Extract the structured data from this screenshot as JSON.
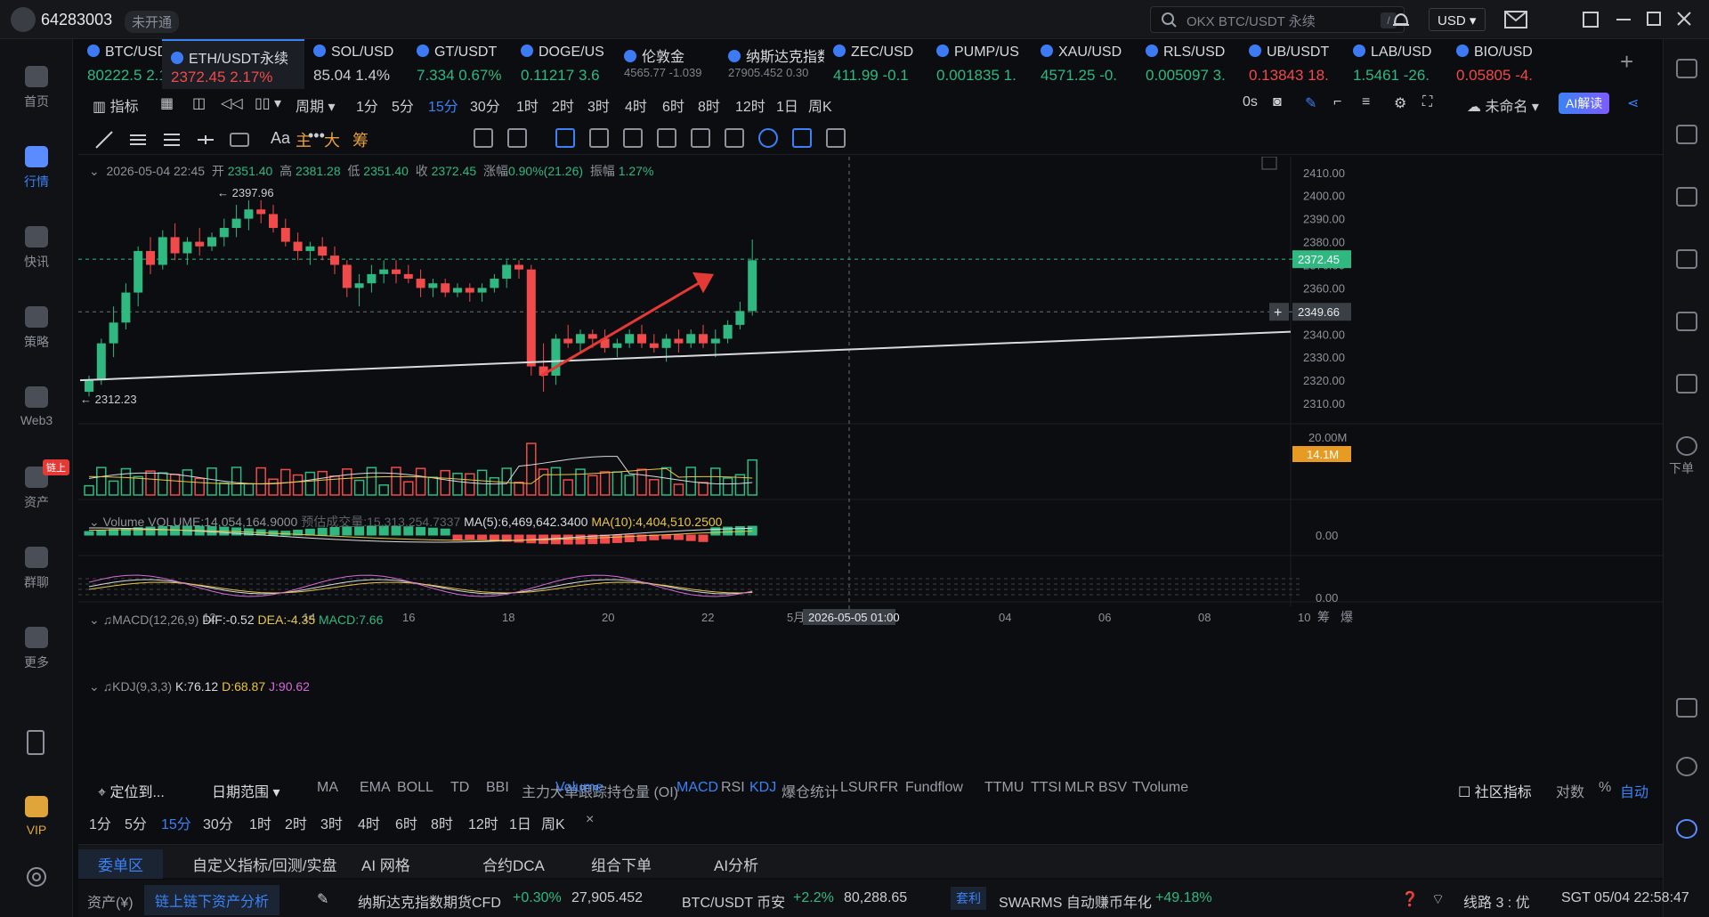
{
  "titlebar": {
    "user_id": "64283003",
    "badge": "未开通",
    "search_placeholder": "OKX BTC/USDT 永续",
    "currency": "USD"
  },
  "nav": [
    {
      "label": "首页"
    },
    {
      "label": "行情"
    },
    {
      "label": "快讯"
    },
    {
      "label": "策略"
    },
    {
      "label": "Web3"
    },
    {
      "label": "资产",
      "tag": "链上"
    },
    {
      "label": "群聊"
    },
    {
      "label": "更多"
    },
    {
      "label": "VIP"
    }
  ],
  "tickers": [
    {
      "name": "BTC/USD",
      "price": "80222.5",
      "change": "2.1",
      "dir": "up"
    },
    {
      "name": "ETH/USDT永续",
      "price": "2372.45",
      "change": "2.17%",
      "dir": "dn"
    },
    {
      "name": "SOL/USD",
      "price": "85.04",
      "change": "1.4%",
      "dir": "none"
    },
    {
      "name": "GT/USDT",
      "price": "7.334",
      "change": "0.67%",
      "dir": "up"
    },
    {
      "name": "DOGE/US",
      "price": "0.11217",
      "change": "3.6",
      "dir": "up"
    },
    {
      "name": "伦敦金",
      "price": "4565.77",
      "change": "-1.039",
      "dir": "mut"
    },
    {
      "name": "纳斯达克指数",
      "price": "27905.452",
      "change": "0.30",
      "dir": "mut"
    },
    {
      "name": "ZEC/USD",
      "price": "411.99",
      "change": "-0.1",
      "dir": "up"
    },
    {
      "name": "PUMP/US",
      "price": "0.001835",
      "change": "1.",
      "dir": "up"
    },
    {
      "name": "XAU/USD",
      "price": "4571.25",
      "change": "-0.",
      "dir": "up"
    },
    {
      "name": "RLS/USD",
      "price": "0.005097",
      "change": "3.",
      "dir": "up"
    },
    {
      "name": "UB/USDT",
      "price": "0.13843",
      "change": "18.",
      "dir": "dn"
    },
    {
      "name": "LAB/USD",
      "price": "1.5461",
      "change": "-26.",
      "dir": "up"
    },
    {
      "name": "BIO/USD",
      "price": "0.05805",
      "change": "-4.",
      "dir": "dn"
    }
  ],
  "toolbar": {
    "indicator": "指标",
    "period": "周期",
    "intervals": [
      "1分",
      "5分",
      "15分",
      "30分",
      "1时",
      "2时",
      "3时",
      "4时",
      "6时",
      "8时",
      "12时",
      "1日",
      "周K"
    ],
    "active_interval": "15分",
    "countdown": "0s",
    "layout_name": "未命名",
    "ai": "AI解读",
    "draw_labels": [
      "Aa",
      "主",
      "大",
      "筹"
    ]
  },
  "ohlc": {
    "date": "2026-05-04 22:45",
    "open_label": "开",
    "open": "2351.40",
    "high_label": "高",
    "high": "2381.28",
    "low_label": "低",
    "low": "2351.40",
    "close_label": "收",
    "close": "2372.45",
    "chg_label": "涨幅",
    "chg": "0.90%(21.26)",
    "amp_label": "振幅",
    "amp": "1.27%"
  },
  "volume_header": {
    "title": "Volume",
    "volume": "VOLUME:14,054,164.9000",
    "est": "预估成交量:15,313,254.7337",
    "ma5": "MA(5):6,469,642.3400",
    "ma10": "MA(10):4,404,510.2500"
  },
  "macd_header": {
    "title": "MACD(12,26,9)",
    "dif": "DIF:-0.52",
    "dea": "DEA:-4.35",
    "macd": "MACD:7.66"
  },
  "kdj_header": {
    "title": "KDJ(9,3,3)",
    "k": "K:76.12",
    "d": "D:68.87",
    "j": "J:90.62"
  },
  "price_axis": [
    "2410.00",
    "2400.00",
    "2390.00",
    "2380.00",
    "2370.00",
    "2360.00",
    "2350.00",
    "2340.00",
    "2330.00",
    "2320.00",
    "2310.00"
  ],
  "price_tags": {
    "last": "2372.45",
    "cross": "2349.66",
    "max": "2397.96",
    "min": "2312.23"
  },
  "vol_axis": {
    "top": "20.00M",
    "tag": "14.1M"
  },
  "macd_axis": "0.00",
  "kdj_axis": "0.00",
  "time_axis": [
    "12",
    "14",
    "16",
    "18",
    "20",
    "22",
    "04",
    "06",
    "08",
    "10"
  ],
  "time_axis_month": "5月",
  "time_cursor": "2026-05-05 01:00",
  "time_right": [
    "筹",
    "爆"
  ],
  "bottom_bar1": {
    "locate": "定位到...",
    "range": "日期范围",
    "indicators": [
      "MA",
      "EMA",
      "BOLL",
      "TD",
      "BBI",
      "主力大单跟踪"
    ],
    "sub_indicators": [
      "Volume",
      "持仓量 (OI)",
      "MACD",
      "RSI",
      "KDJ",
      "爆仓统计",
      "LSUR",
      "FR",
      "Fundflow",
      "TTMU",
      "TTSI",
      "MLR",
      "BSV",
      "TVolume"
    ],
    "community": "社区指标",
    "log": "对数",
    "pct": "%",
    "auto": "自动"
  },
  "bottom_bar2": [
    "1分",
    "5分",
    "15分",
    "30分",
    "1时",
    "2时",
    "3时",
    "4时",
    "6时",
    "8时",
    "12时",
    "1日",
    "周K"
  ],
  "tabs": [
    "委单区",
    "自定义指标/回测/实盘",
    "AI 网格",
    "合约DCA",
    "组合下单",
    "AI分析"
  ],
  "status": {
    "assets": "资产(¥)",
    "analysis": "链上链下资产分析",
    "nasdaq_name": "纳斯达克指数期货CFD",
    "nasdaq_chg": "+0.30%",
    "nasdaq_px": "27,905.452",
    "btc_name": "BTC/USDT 币安",
    "btc_chg": "+2.2%",
    "btc_px": "80,288.65",
    "arb_tag": "套利",
    "swarms": "SWARMS 自动赚币年化",
    "swarms_chg": "+49.18%",
    "line": "线路 3 : 优",
    "time": "SGT 05/04 22:58:47"
  },
  "right_tools": [
    {
      "label": "下单"
    }
  ],
  "colors": {
    "up": "#2fb980",
    "down": "#f04a4a",
    "accent": "#3b82f6",
    "ma10": "#e8c547"
  },
  "chart_data": {
    "type": "candlestick",
    "x_times": [
      "12",
      "14",
      "16",
      "18",
      "20",
      "22"
    ],
    "ylim": [
      2305,
      2413
    ],
    "candles": [
      [
        2315,
        2322,
        2313,
        2320
      ],
      [
        2320,
        2338,
        2318,
        2336
      ],
      [
        2336,
        2352,
        2330,
        2345
      ],
      [
        2345,
        2362,
        2342,
        2358
      ],
      [
        2358,
        2378,
        2352,
        2376
      ],
      [
        2376,
        2382,
        2366,
        2370
      ],
      [
        2370,
        2385,
        2368,
        2382
      ],
      [
        2382,
        2388,
        2372,
        2375
      ],
      [
        2375,
        2382,
        2370,
        2380
      ],
      [
        2380,
        2386,
        2374,
        2378
      ],
      [
        2378,
        2384,
        2376,
        2382
      ],
      [
        2382,
        2390,
        2378,
        2386
      ],
      [
        2386,
        2396,
        2382,
        2390
      ],
      [
        2390,
        2398,
        2385,
        2394
      ],
      [
        2394,
        2398,
        2388,
        2392
      ],
      [
        2392,
        2396,
        2384,
        2386
      ],
      [
        2386,
        2390,
        2378,
        2380
      ],
      [
        2380,
        2384,
        2372,
        2376
      ],
      [
        2376,
        2380,
        2370,
        2378
      ],
      [
        2378,
        2382,
        2372,
        2374
      ],
      [
        2374,
        2378,
        2366,
        2370
      ],
      [
        2370,
        2372,
        2356,
        2360
      ],
      [
        2360,
        2366,
        2352,
        2362
      ],
      [
        2362,
        2370,
        2358,
        2366
      ],
      [
        2366,
        2372,
        2362,
        2368
      ],
      [
        2368,
        2372,
        2362,
        2366
      ],
      [
        2366,
        2370,
        2362,
        2364
      ],
      [
        2364,
        2368,
        2356,
        2360
      ],
      [
        2360,
        2364,
        2356,
        2362
      ],
      [
        2362,
        2364,
        2356,
        2358
      ],
      [
        2358,
        2362,
        2356,
        2360
      ],
      [
        2360,
        2362,
        2354,
        2358
      ],
      [
        2358,
        2362,
        2354,
        2360
      ],
      [
        2360,
        2366,
        2358,
        2364
      ],
      [
        2364,
        2372,
        2360,
        2370
      ],
      [
        2370,
        2372,
        2364,
        2368
      ],
      [
        2368,
        2370,
        2322,
        2326
      ],
      [
        2326,
        2336,
        2315,
        2322
      ],
      [
        2322,
        2340,
        2318,
        2338
      ],
      [
        2338,
        2344,
        2334,
        2336
      ],
      [
        2336,
        2342,
        2332,
        2340
      ],
      [
        2340,
        2342,
        2334,
        2338
      ],
      [
        2338,
        2342,
        2332,
        2334
      ],
      [
        2334,
        2338,
        2330,
        2336
      ],
      [
        2336,
        2342,
        2334,
        2340
      ],
      [
        2340,
        2344,
        2334,
        2336
      ],
      [
        2336,
        2340,
        2332,
        2334
      ],
      [
        2334,
        2340,
        2328,
        2338
      ],
      [
        2338,
        2342,
        2332,
        2336
      ],
      [
        2336,
        2342,
        2334,
        2340
      ],
      [
        2340,
        2344,
        2334,
        2336
      ],
      [
        2336,
        2342,
        2330,
        2338
      ],
      [
        2338,
        2346,
        2336,
        2344
      ],
      [
        2344,
        2354,
        2342,
        2350
      ],
      [
        2350,
        2381,
        2348,
        2372
      ]
    ],
    "trendline": [
      [
        0,
        2320
      ],
      [
        1,
        2341
      ]
    ]
  }
}
